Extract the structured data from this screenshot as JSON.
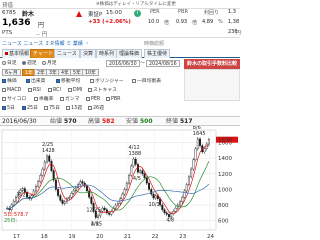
{
  "header": {
    "kind": "貸借",
    "delay_note": "※株価はディレイ・リアルタイムに変更",
    "code": "6785",
    "name": "鈴木",
    "price": "1,636",
    "price_unit": "円",
    "market": "東証P",
    "time": "15:00",
    "change": "+33 (+2.06%)",
    "pts_label": "PTS",
    "pts_value": "-- 円"
  },
  "stats": {
    "col1_label": "PER",
    "col2_label": "PBR",
    "col3_label": "利回り",
    "per": "10.0",
    "pbr": "0.93",
    "yield": "4.89",
    "per_unit": "倍",
    "pbr_unit": "倍",
    "yield_unit": "%",
    "r2a": "1.3",
    "r2b": "236",
    "r3": "1,38",
    "r3_unit": "円"
  },
  "news": {
    "text": "ニュース  ニュース  ＩＲ情報  ミ  業績  ・",
    "right": "時価総額"
  },
  "tabs": [
    {
      "label": "基本情報",
      "active": false
    },
    {
      "label": "チャート",
      "active": true
    },
    {
      "label": "ニュース",
      "active": false
    },
    {
      "label": "決算",
      "active": false
    },
    {
      "label": "時系列",
      "active": false
    },
    {
      "label": "理論株価",
      "active": false
    },
    {
      "label": "株主優待",
      "active": false
    }
  ],
  "controls": {
    "period_label": "日足",
    "scale_label": "週足",
    "month_label": "月足",
    "buttons": [
      "6ヶ月",
      "1年",
      "2年",
      "3年",
      "4年",
      "5年",
      "10年"
    ],
    "selected_button": "1年",
    "date_from": "2016/06/30",
    "date_to": "2024/08/16",
    "options_row": [
      "株価",
      "出来高",
      "移動平均",
      "ボリンジャー",
      "一目均衡表"
    ],
    "ma_row": [
      "5日",
      "25日",
      "75日",
      "13週",
      "26週"
    ],
    "ind_row": [
      "MACD",
      "RSI",
      "RCI",
      "DMI",
      "ストキャス"
    ],
    "ind_row2": [
      "サイコロ",
      "乖離率",
      "ガンマ",
      "PER",
      "PBR"
    ],
    "right_panel_title": "鈴木の取引手数料比較"
  },
  "ohlc": {
    "date": "2016/06/30",
    "open_label": "始値",
    "open": "570",
    "high_label": "高値",
    "high": "582",
    "low_label": "安値",
    "low": "500",
    "close_label": "終値",
    "close": "517"
  },
  "chart_data": {
    "type": "candlestick",
    "title": "",
    "y_ticks": [
      "1600",
      "1400",
      "1200",
      "1000",
      "800",
      "600"
    ],
    "ylim": [
      480,
      1760
    ],
    "x_ticks": [
      "17",
      "18",
      "19",
      "20",
      "21",
      "22",
      "23",
      "24"
    ],
    "annotations": [
      {
        "label": "2/25",
        "sub": "1428",
        "x_frac": 0.0,
        "value": 1428
      },
      {
        "label": "6/24",
        "sub": "",
        "value": 1010
      },
      {
        "label": "3/15",
        "sub": "",
        "value": 640
      },
      {
        "label": "4/8",
        "sub": "",
        "value": 640
      },
      {
        "label": "12/25",
        "sub": "",
        "value": 820
      },
      {
        "label": "4/12",
        "sub": "1388",
        "value": 1388
      },
      {
        "label": "4/5",
        "sub": "",
        "value": 1220
      },
      {
        "label": "10/3",
        "sub": "",
        "value": 890
      },
      {
        "label": "8/6",
        "sub": "1645",
        "value": 1645
      },
      {
        "label": "4/8",
        "sub": "",
        "value": 690
      }
    ],
    "ma_legend": [
      "5日:",
      "25日:",
      "75日:",
      "13週:",
      "26週:"
    ],
    "ma_values": [
      "578.7",
      "",
      "",
      "",
      ""
    ],
    "last_close": 1636,
    "series": [
      {
        "name": "price",
        "values": [
          760,
          740,
          800,
          850,
          900,
          960,
          990,
          1010,
          960,
          900,
          880,
          920,
          980,
          1040,
          1100,
          1180,
          1260,
          1350,
          1428,
          1360,
          1240,
          1120,
          1000,
          920,
          860,
          820,
          840,
          880,
          900,
          950,
          980,
          1020,
          1060,
          1100,
          1080,
          1040,
          980,
          900,
          820,
          720,
          640,
          660,
          720,
          760,
          740,
          700,
          680,
          720,
          760,
          800,
          820,
          880,
          940,
          1000,
          1080,
          1180,
          1300,
          1388,
          1320,
          1220,
          1240,
          1200,
          1150,
          1080,
          1000,
          940,
          890,
          920,
          880,
          800,
          740,
          700,
          680,
          650,
          690,
          720,
          760,
          800,
          840,
          900,
          980,
          1060,
          1160,
          1260,
          1380,
          1520,
          1645,
          1560,
          1480,
          1520,
          1580,
          1636
        ]
      }
    ]
  }
}
